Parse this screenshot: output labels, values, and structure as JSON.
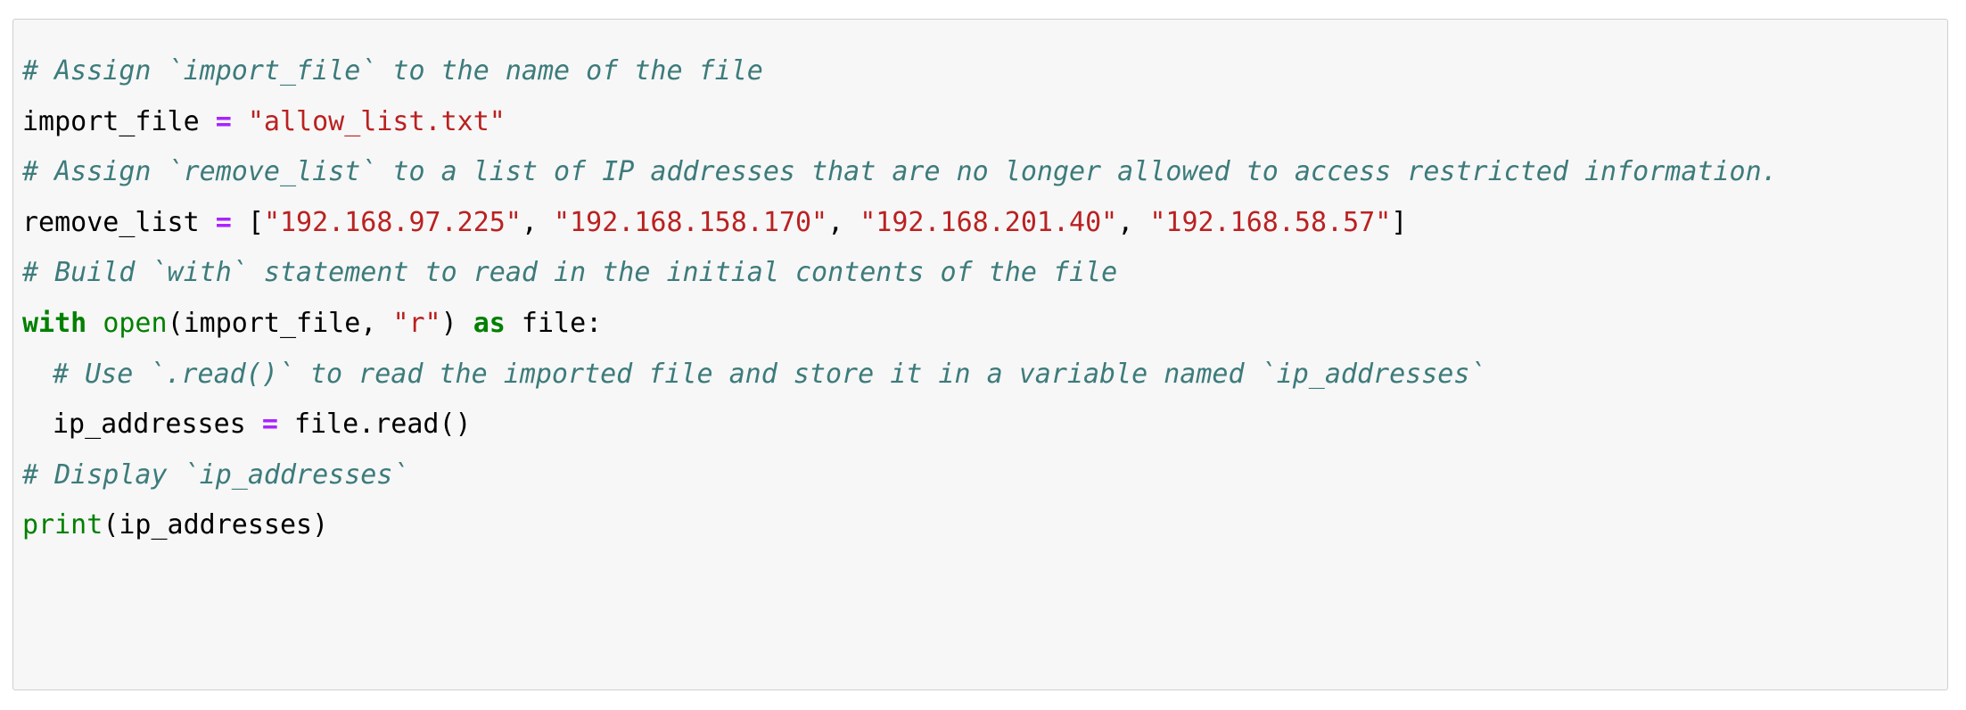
{
  "colors": {
    "comment": "#3d7b7b",
    "string": "#ba2121",
    "operator": "#aa22ff",
    "keyword": "#008000",
    "builtin": "#008000",
    "background": "#f7f7f7",
    "border": "#cfcfcf"
  },
  "code": {
    "line1": {
      "comment": "# Assign `import_file` to the name of the file"
    },
    "line2": {
      "name": "import_file",
      "op": "=",
      "string": "\"allow_list.txt\""
    },
    "line3": {
      "comment": "# Assign `remove_list` to a list of IP addresses that are no longer allowed to access restricted information."
    },
    "line4": {
      "name": "remove_list",
      "op": "=",
      "open": "[",
      "ip1": "\"192.168.97.225\"",
      "ip2": "\"192.168.158.170\"",
      "ip3": "\"192.168.201.40\"",
      "ip4": "\"192.168.58.57\"",
      "sep": ", ",
      "close": "]"
    },
    "line5": {
      "comment": "# Build `with` statement to read in the initial contents of the file"
    },
    "line6": {
      "kw_with": "with",
      "builtin_open": "open",
      "args_start": "(import_file, ",
      "mode": "\"r\"",
      "args_end": ") ",
      "kw_as": "as",
      "target": " file:"
    },
    "line7": {
      "comment": "# Use `.read()` to read the imported file and store it in a variable named `ip_addresses`"
    },
    "line8": {
      "name": "ip_addresses",
      "op": "=",
      "call": "file.read()"
    },
    "line9": {
      "comment": "# Display `ip_addresses`"
    },
    "line10": {
      "builtin_print": "print",
      "args": "(ip_addresses)"
    }
  }
}
